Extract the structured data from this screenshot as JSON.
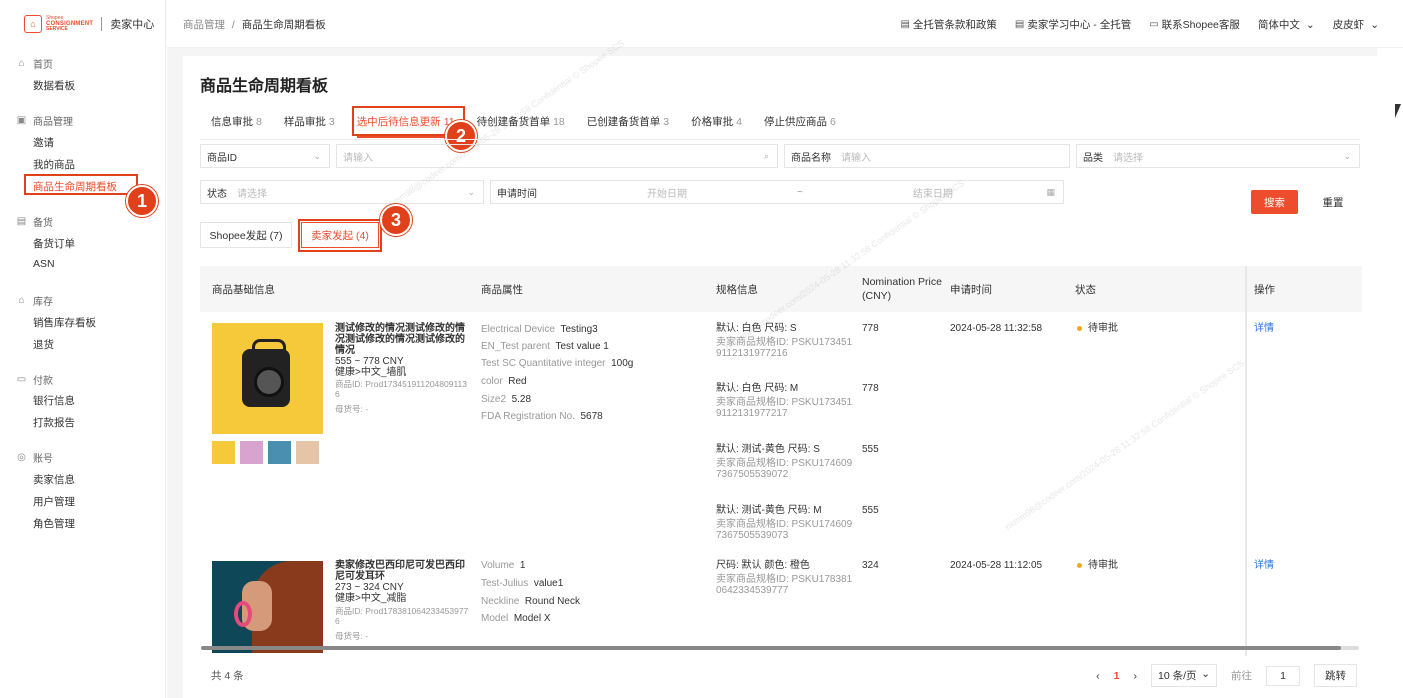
{
  "brand": {
    "logo_l1": "Shopee",
    "logo_l2": "CONSIGNMENT",
    "logo_l3": "SERVICE",
    "center": "卖家中心",
    "accent": "#ee4d2d"
  },
  "sidebar": {
    "groups": [
      {
        "head": "首页",
        "icon": "home-icon",
        "items": [
          "数据看板"
        ]
      },
      {
        "head": "商品管理",
        "icon": "box-icon",
        "items": [
          "邀请",
          "我的商品",
          "商品生命周期看板"
        ]
      },
      {
        "head": "备货",
        "icon": "clipboard-icon",
        "items": [
          "备货订单",
          "ASN"
        ]
      },
      {
        "head": "库存",
        "icon": "warehouse-icon",
        "items": [
          "销售库存看板",
          "退货"
        ]
      },
      {
        "head": "付款",
        "icon": "wallet-icon",
        "items": [
          "银行信息",
          "打款报告"
        ]
      },
      {
        "head": "账号",
        "icon": "user-icon",
        "items": [
          "卖家信息",
          "用户管理",
          "角色管理"
        ]
      }
    ]
  },
  "breadcrumb": {
    "parent": "商品管理",
    "sep": "/",
    "current": "商品生命周期看板"
  },
  "top_links": [
    "全托管条款和政策",
    "卖家学习中心 - 全托管",
    "联系Shopee客服",
    "简体中文",
    "皮皮虾"
  ],
  "page_title": "商品生命周期看板",
  "tabs": [
    {
      "label": "信息审批",
      "count": "8"
    },
    {
      "label": "样品审批",
      "count": "3"
    },
    {
      "label": "选中后待信息更新",
      "count": "11"
    },
    {
      "label": "待创建备货首单",
      "count": "18"
    },
    {
      "label": "已创建备货首单",
      "count": "3"
    },
    {
      "label": "价格审批",
      "count": "4"
    },
    {
      "label": "停止供应商品",
      "count": "6"
    }
  ],
  "filters": {
    "product_id_label": "商品ID",
    "product_id_ph": "请输入",
    "product_name_label": "商品名称",
    "product_name_ph": "请输入",
    "category_label": "品类",
    "category_ph": "请选择",
    "status_label": "状态",
    "status_ph": "请选择",
    "apply_time_label": "申请时间",
    "start_ph": "开始日期",
    "range_sep": "~",
    "end_ph": "结束日期",
    "search_btn": "搜索",
    "reset_btn": "重置"
  },
  "subtabs": [
    {
      "label": "Shopee发起 (7)"
    },
    {
      "label": "卖家发起 (4)"
    }
  ],
  "columns": [
    "商品基础信息",
    "商品属性",
    "规格信息",
    "Nomination Price (CNY)",
    "申请时间",
    "状态",
    "操作"
  ],
  "rows": [
    {
      "name": "测试修改的情况测试修改的情况测试修改的情况测试修改的情况",
      "price_range": "555 ~ 778 CNY",
      "category": "健康>中文_墙肌",
      "product_id": "商品ID: Prod1734519112048091136",
      "goods_no": "母货号: -",
      "attrs": [
        {
          "k": "Electrical Device",
          "v": "Testing3"
        },
        {
          "k": "EN_Test parent",
          "v": "Test value 1"
        },
        {
          "k": "Test SC Quantitative integer",
          "v": "100g"
        },
        {
          "k": "color",
          "v": "Red"
        },
        {
          "k": "Size2",
          "v": "5.28"
        },
        {
          "k": "FDA Registration No.",
          "v": "5678"
        }
      ],
      "specs": [
        {
          "line1": "默认: 白色   尺码: S",
          "line2": "卖家商品规格ID: PSKU1734519112131977216",
          "price": "778"
        },
        {
          "line1": "默认: 白色   尺码: M",
          "line2": "卖家商品规格ID: PSKU1734519112131977217",
          "price": "778"
        },
        {
          "line1": "默认: 测试-黄色   尺码: S",
          "line2": "卖家商品规格ID: PSKU1746097367505539072",
          "price": "555"
        },
        {
          "line1": "默认: 测试-黄色   尺码: M",
          "line2": "卖家商品规格ID: PSKU1746097367505539073",
          "price": "555"
        }
      ],
      "apply_time": "2024-05-28 11:32:58",
      "status": "待审批",
      "action": "详情"
    },
    {
      "name": "卖家修改巴西印尼可发巴西印尼可发耳环",
      "price_range": "273 ~ 324 CNY",
      "category": "健康>中文_减脂",
      "product_id": "商品ID: Prod1783810642334539776",
      "goods_no": "母货号: -",
      "attrs": [
        {
          "k": "Volume",
          "v": "1"
        },
        {
          "k": "Test-Julius",
          "v": "value1"
        },
        {
          "k": "Neckline",
          "v": "Round Neck"
        },
        {
          "k": "Model",
          "v": "Model X"
        }
      ],
      "specs": [
        {
          "line1": "尺码: 默认   颜色: 橙色",
          "line2": "卖家商品规格ID: PSKU1783810642334539777",
          "price": "324"
        }
      ],
      "apply_time": "2024-05-28 11:12:05",
      "status": "待审批",
      "action": "详情"
    }
  ],
  "footer": {
    "total": "共 4 条",
    "page": "1",
    "page_size": "10 条/页",
    "goto_label": "前往",
    "goto_value": "1",
    "go_btn": "跳转"
  },
  "annotations": [
    "1",
    "2",
    "3"
  ],
  "watermark": "nkmm98@codeer.com/2024-05-28 11:32:58 Confidential © Shopee SCS"
}
